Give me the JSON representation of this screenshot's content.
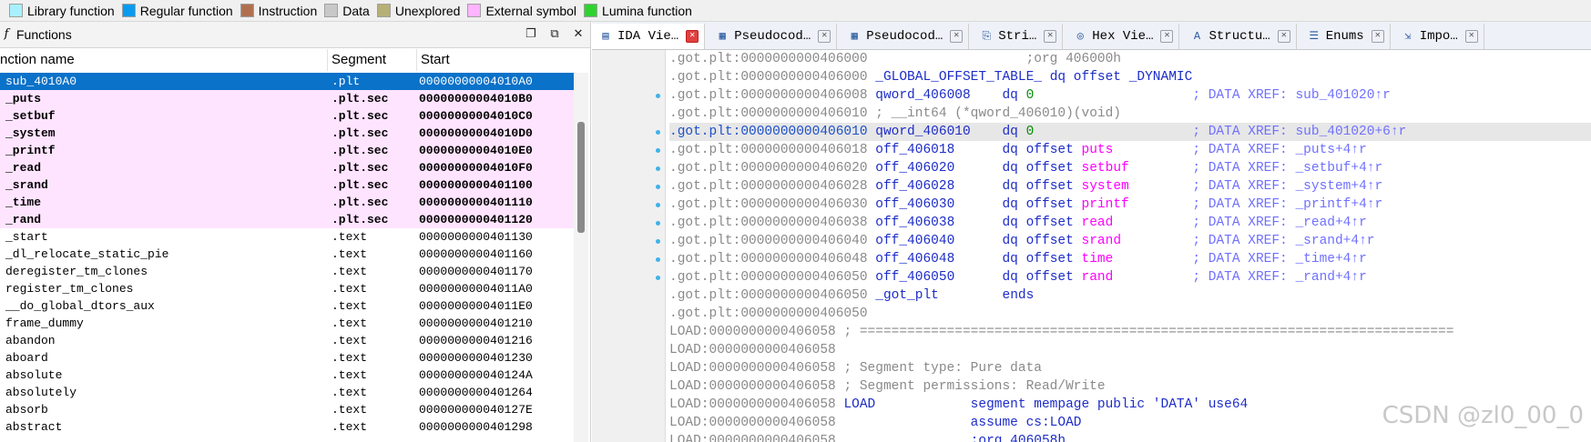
{
  "legend": [
    {
      "label": "Library function",
      "color": "#a8f0ff"
    },
    {
      "label": "Regular function",
      "color": "#0a9bf0"
    },
    {
      "label": "Instruction",
      "color": "#b07050"
    },
    {
      "label": "Data",
      "color": "#c8c8c8"
    },
    {
      "label": "Unexplored",
      "color": "#b5b075"
    },
    {
      "label": "External symbol",
      "color": "#ffb4ff"
    },
    {
      "label": "Lumina function",
      "color": "#2ed32e"
    }
  ],
  "functions_panel": {
    "title": "Functions",
    "columns": [
      "nction name",
      "Segment",
      "Start"
    ],
    "rows": [
      {
        "name": "sub_4010A0",
        "segment": ".plt",
        "start": "00000000004010A0",
        "kind": "selected"
      },
      {
        "name": "_puts",
        "segment": ".plt.sec",
        "start": "00000000004010B0",
        "kind": "ext"
      },
      {
        "name": "_setbuf",
        "segment": ".plt.sec",
        "start": "00000000004010C0",
        "kind": "ext"
      },
      {
        "name": "_system",
        "segment": ".plt.sec",
        "start": "00000000004010D0",
        "kind": "ext"
      },
      {
        "name": "_printf",
        "segment": ".plt.sec",
        "start": "00000000004010E0",
        "kind": "ext"
      },
      {
        "name": "_read",
        "segment": ".plt.sec",
        "start": "00000000004010F0",
        "kind": "ext"
      },
      {
        "name": "_srand",
        "segment": ".plt.sec",
        "start": "0000000000401100",
        "kind": "ext"
      },
      {
        "name": "_time",
        "segment": ".plt.sec",
        "start": "0000000000401110",
        "kind": "ext"
      },
      {
        "name": "_rand",
        "segment": ".plt.sec",
        "start": "0000000000401120",
        "kind": "ext"
      },
      {
        "name": "_start",
        "segment": ".text",
        "start": "0000000000401130",
        "kind": "normal"
      },
      {
        "name": "_dl_relocate_static_pie",
        "segment": ".text",
        "start": "0000000000401160",
        "kind": "normal"
      },
      {
        "name": "deregister_tm_clones",
        "segment": ".text",
        "start": "0000000000401170",
        "kind": "normal"
      },
      {
        "name": "register_tm_clones",
        "segment": ".text",
        "start": "00000000004011A0",
        "kind": "normal"
      },
      {
        "name": "__do_global_dtors_aux",
        "segment": ".text",
        "start": "00000000004011E0",
        "kind": "normal"
      },
      {
        "name": "frame_dummy",
        "segment": ".text",
        "start": "0000000000401210",
        "kind": "normal"
      },
      {
        "name": "abandon",
        "segment": ".text",
        "start": "0000000000401216",
        "kind": "normal"
      },
      {
        "name": "aboard",
        "segment": ".text",
        "start": "0000000000401230",
        "kind": "normal"
      },
      {
        "name": "absolute",
        "segment": ".text",
        "start": "000000000040124A",
        "kind": "normal"
      },
      {
        "name": "absolutely",
        "segment": ".text",
        "start": "0000000000401264",
        "kind": "normal"
      },
      {
        "name": "absorb",
        "segment": ".text",
        "start": "000000000040127E",
        "kind": "normal"
      },
      {
        "name": "abstract",
        "segment": ".text",
        "start": "0000000000401298",
        "kind": "normal"
      }
    ]
  },
  "tabs": [
    {
      "label": "IDA Vie…",
      "icon": "graph-icon",
      "active": true
    },
    {
      "label": "Pseudocod…",
      "icon": "pseudocode-icon",
      "active": false
    },
    {
      "label": "Pseudocod…",
      "icon": "pseudocode-icon",
      "active": false
    },
    {
      "label": "Stri…",
      "icon": "strings-icon",
      "active": false
    },
    {
      "label": "Hex Vie…",
      "icon": "hex-icon",
      "active": false
    },
    {
      "label": "Structu…",
      "icon": "structure-icon",
      "active": false
    },
    {
      "label": "Enums",
      "icon": "enums-icon",
      "active": false
    },
    {
      "label": "Impo…",
      "icon": "imports-icon",
      "active": false
    }
  ],
  "disassembly": [
    {
      "addr": ".got.plt:0000000000406000",
      "parts": [
        [
          "",
          "                    "
        ],
        [
          "gcmt",
          ";org 406000h"
        ]
      ]
    },
    {
      "addr": ".got.plt:0000000000406000",
      "parts": [
        [
          "",
          " "
        ],
        [
          "lbl",
          "_GLOBAL_OFFSET_TABLE_"
        ],
        [
          "",
          " "
        ],
        [
          "mn",
          "dq offset _DYNAMIC"
        ]
      ]
    },
    {
      "addr": ".got.plt:0000000000406008",
      "dot": true,
      "parts": [
        [
          "",
          " "
        ],
        [
          "lbl",
          "qword_406008"
        ],
        [
          "",
          "    "
        ],
        [
          "mn",
          "dq"
        ],
        [
          "",
          " "
        ],
        [
          "num",
          "0"
        ],
        [
          "",
          "                    "
        ],
        [
          "cmt",
          "; DATA XREF: sub_401020↑r"
        ]
      ]
    },
    {
      "addr": ".got.plt:0000000000406010",
      "parts": [
        [
          "",
          " "
        ],
        [
          "gcmt",
          "; __int64 (*qword_406010)(void)"
        ]
      ]
    },
    {
      "addr": ".got.plt:0000000000406010",
      "dot": true,
      "hl": true,
      "parts": [
        [
          "",
          " "
        ],
        [
          "lbl",
          "qword_406010"
        ],
        [
          "",
          "    "
        ],
        [
          "mn",
          "dq"
        ],
        [
          "",
          " "
        ],
        [
          "num",
          "0"
        ],
        [
          "",
          "                    "
        ],
        [
          "cmt",
          "; DATA XREF: sub_401020+6↑r"
        ]
      ]
    },
    {
      "addr": ".got.plt:0000000000406018",
      "dot": true,
      "parts": [
        [
          "",
          " "
        ],
        [
          "lbl",
          "off_406018"
        ],
        [
          "",
          "      "
        ],
        [
          "mn",
          "dq offset"
        ],
        [
          "",
          " "
        ],
        [
          "ext-sym",
          "puts"
        ],
        [
          "",
          "          "
        ],
        [
          "cmt",
          "; DATA XREF: _puts+4↑r"
        ]
      ]
    },
    {
      "addr": ".got.plt:0000000000406020",
      "dot": true,
      "parts": [
        [
          "",
          " "
        ],
        [
          "lbl",
          "off_406020"
        ],
        [
          "",
          "      "
        ],
        [
          "mn",
          "dq offset"
        ],
        [
          "",
          " "
        ],
        [
          "ext-sym",
          "setbuf"
        ],
        [
          "",
          "        "
        ],
        [
          "cmt",
          "; DATA XREF: _setbuf+4↑r"
        ]
      ]
    },
    {
      "addr": ".got.plt:0000000000406028",
      "dot": true,
      "parts": [
        [
          "",
          " "
        ],
        [
          "lbl",
          "off_406028"
        ],
        [
          "",
          "      "
        ],
        [
          "mn",
          "dq offset"
        ],
        [
          "",
          " "
        ],
        [
          "ext-sym",
          "system"
        ],
        [
          "",
          "        "
        ],
        [
          "cmt",
          "; DATA XREF: _system+4↑r"
        ]
      ]
    },
    {
      "addr": ".got.plt:0000000000406030",
      "dot": true,
      "parts": [
        [
          "",
          " "
        ],
        [
          "lbl",
          "off_406030"
        ],
        [
          "",
          "      "
        ],
        [
          "mn",
          "dq offset"
        ],
        [
          "",
          " "
        ],
        [
          "ext-sym",
          "printf"
        ],
        [
          "",
          "        "
        ],
        [
          "cmt",
          "; DATA XREF: _printf+4↑r"
        ]
      ]
    },
    {
      "addr": ".got.plt:0000000000406038",
      "dot": true,
      "parts": [
        [
          "",
          " "
        ],
        [
          "lbl",
          "off_406038"
        ],
        [
          "",
          "      "
        ],
        [
          "mn",
          "dq offset"
        ],
        [
          "",
          " "
        ],
        [
          "ext-sym",
          "read"
        ],
        [
          "",
          "          "
        ],
        [
          "cmt",
          "; DATA XREF: _read+4↑r"
        ]
      ]
    },
    {
      "addr": ".got.plt:0000000000406040",
      "dot": true,
      "parts": [
        [
          "",
          " "
        ],
        [
          "lbl",
          "off_406040"
        ],
        [
          "",
          "      "
        ],
        [
          "mn",
          "dq offset"
        ],
        [
          "",
          " "
        ],
        [
          "ext-sym",
          "srand"
        ],
        [
          "",
          "         "
        ],
        [
          "cmt",
          "; DATA XREF: _srand+4↑r"
        ]
      ]
    },
    {
      "addr": ".got.plt:0000000000406048",
      "dot": true,
      "parts": [
        [
          "",
          " "
        ],
        [
          "lbl",
          "off_406048"
        ],
        [
          "",
          "      "
        ],
        [
          "mn",
          "dq offset"
        ],
        [
          "",
          " "
        ],
        [
          "ext-sym",
          "time"
        ],
        [
          "",
          "          "
        ],
        [
          "cmt",
          "; DATA XREF: _time+4↑r"
        ]
      ]
    },
    {
      "addr": ".got.plt:0000000000406050",
      "dot": true,
      "parts": [
        [
          "",
          " "
        ],
        [
          "lbl",
          "off_406050"
        ],
        [
          "",
          "      "
        ],
        [
          "mn",
          "dq offset"
        ],
        [
          "",
          " "
        ],
        [
          "ext-sym",
          "rand"
        ],
        [
          "",
          "          "
        ],
        [
          "cmt",
          "; DATA XREF: _rand+4↑r"
        ]
      ]
    },
    {
      "addr": ".got.plt:0000000000406050",
      "parts": [
        [
          "",
          " "
        ],
        [
          "lbl",
          "_got_plt"
        ],
        [
          "",
          "        "
        ],
        [
          "mn",
          "ends"
        ]
      ]
    },
    {
      "addr": ".got.plt:0000000000406050",
      "parts": []
    },
    {
      "addr": "LOAD:0000000000406058",
      "parts": [
        [
          "",
          " "
        ],
        [
          "gcmt",
          "; ==========================================================================="
        ]
      ]
    },
    {
      "addr": "LOAD:0000000000406058",
      "parts": []
    },
    {
      "addr": "LOAD:0000000000406058",
      "parts": [
        [
          "",
          " "
        ],
        [
          "gcmt",
          "; Segment type: Pure data"
        ]
      ]
    },
    {
      "addr": "LOAD:0000000000406058",
      "parts": [
        [
          "",
          " "
        ],
        [
          "gcmt",
          "; Segment permissions: Read/Write"
        ]
      ]
    },
    {
      "addr": "LOAD:0000000000406058",
      "parts": [
        [
          "",
          " "
        ],
        [
          "lbl",
          "LOAD"
        ],
        [
          "",
          "            "
        ],
        [
          "mn",
          "segment mempage public 'DATA' use64"
        ]
      ]
    },
    {
      "addr": "LOAD:0000000000406058",
      "parts": [
        [
          "",
          "                 "
        ],
        [
          "mn",
          "assume cs:LOAD"
        ]
      ]
    },
    {
      "addr": "LOAD:0000000000406058",
      "parts": [
        [
          "",
          "                 "
        ],
        [
          "mn",
          ";org 406058h"
        ]
      ]
    }
  ],
  "watermark": "CSDN @zl0_00_0"
}
